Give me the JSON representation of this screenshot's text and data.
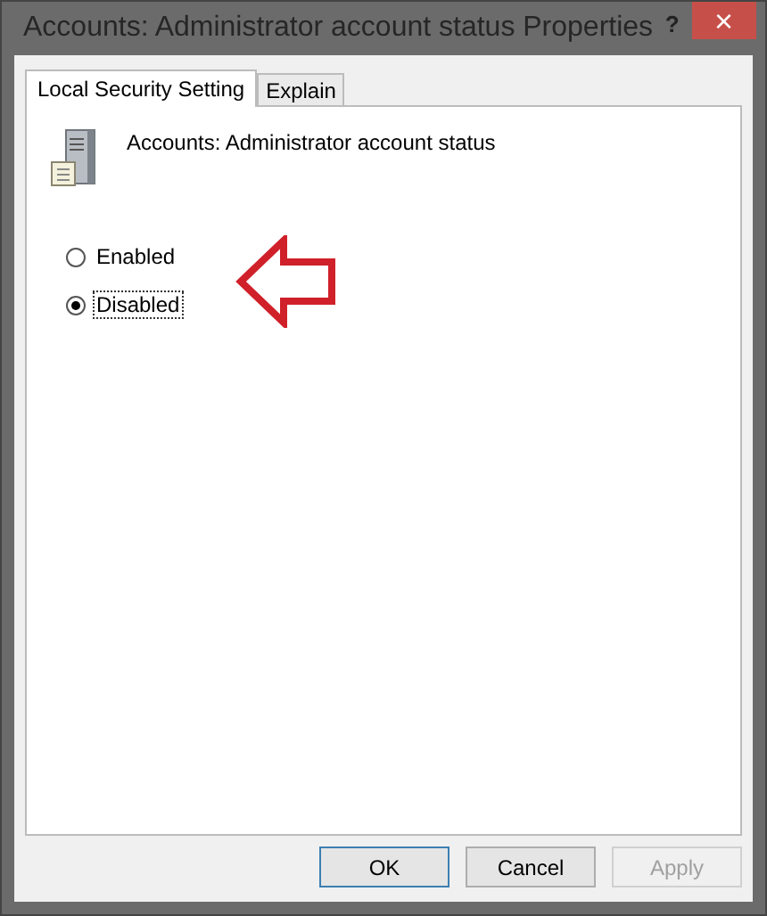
{
  "window": {
    "title": "Accounts: Administrator account status Properties",
    "help": "?",
    "close": "×"
  },
  "tabs": [
    {
      "label": "Local Security Setting",
      "selected": true
    },
    {
      "label": "Explain",
      "selected": false
    }
  ],
  "policy": {
    "name": "Accounts: Administrator account status"
  },
  "options": [
    {
      "label": "Enabled",
      "selected": false
    },
    {
      "label": "Disabled",
      "selected": true
    }
  ],
  "buttons": [
    {
      "label": "OK",
      "disabled": false,
      "default": true
    },
    {
      "label": "Cancel",
      "disabled": false,
      "default": false
    },
    {
      "label": "Apply",
      "disabled": true,
      "default": false
    }
  ]
}
